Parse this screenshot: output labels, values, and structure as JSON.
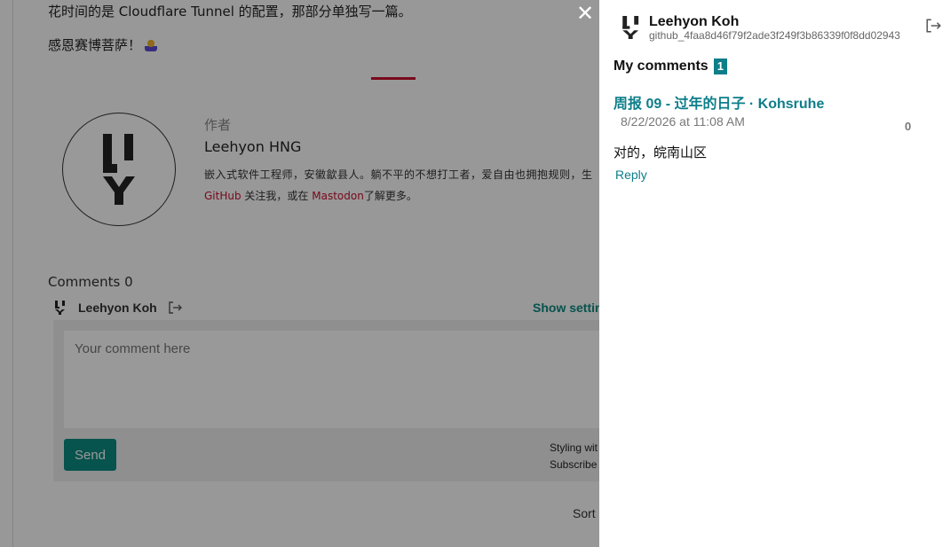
{
  "article": {
    "line1": "花时间的是 Cloudflare Tunnel 的配置，那部分单独写一篇。",
    "line2": "感恩赛博菩萨！"
  },
  "author": {
    "label": "作者",
    "name": "Leehyon HNG",
    "bio": "嵌入式软件工程师，安徽歙县人。躺不平的不想打工者，爱自由也拥抱规则，生",
    "bio_link1": "GitHub",
    "bio_mid": " 关注我，或在 ",
    "bio_link2": "Mastodon",
    "bio_end": "了解更多。"
  },
  "comments": {
    "title": "Comments 0",
    "user_name": "Leehyon Koh",
    "show_settings": "Show settin",
    "placeholder": "Your comment here",
    "send_label": "Send",
    "styling_line1": "Styling wit",
    "styling_line2": "Subscribe",
    "sort_label": "Sort"
  },
  "overlay": {
    "close_symbol": "✕"
  },
  "panel": {
    "name": "Leehyon Koh",
    "id": "github_4faa8d46f79f2ade3f249f3b86339f0f8dd02943",
    "my_comments_label": "My comments",
    "my_comments_count": "1",
    "comment": {
      "post_title": "周报 09 - 过年的日子 · Kohsruhe",
      "date": "8/22/2026 at 11:08 AM",
      "votes": "0",
      "body": "对的，皖南山区",
      "reply_label": "Reply"
    }
  },
  "colors": {
    "accent": "#0d7e8a",
    "send_button": "#0d8a80",
    "divider_red": "#c8102e"
  }
}
